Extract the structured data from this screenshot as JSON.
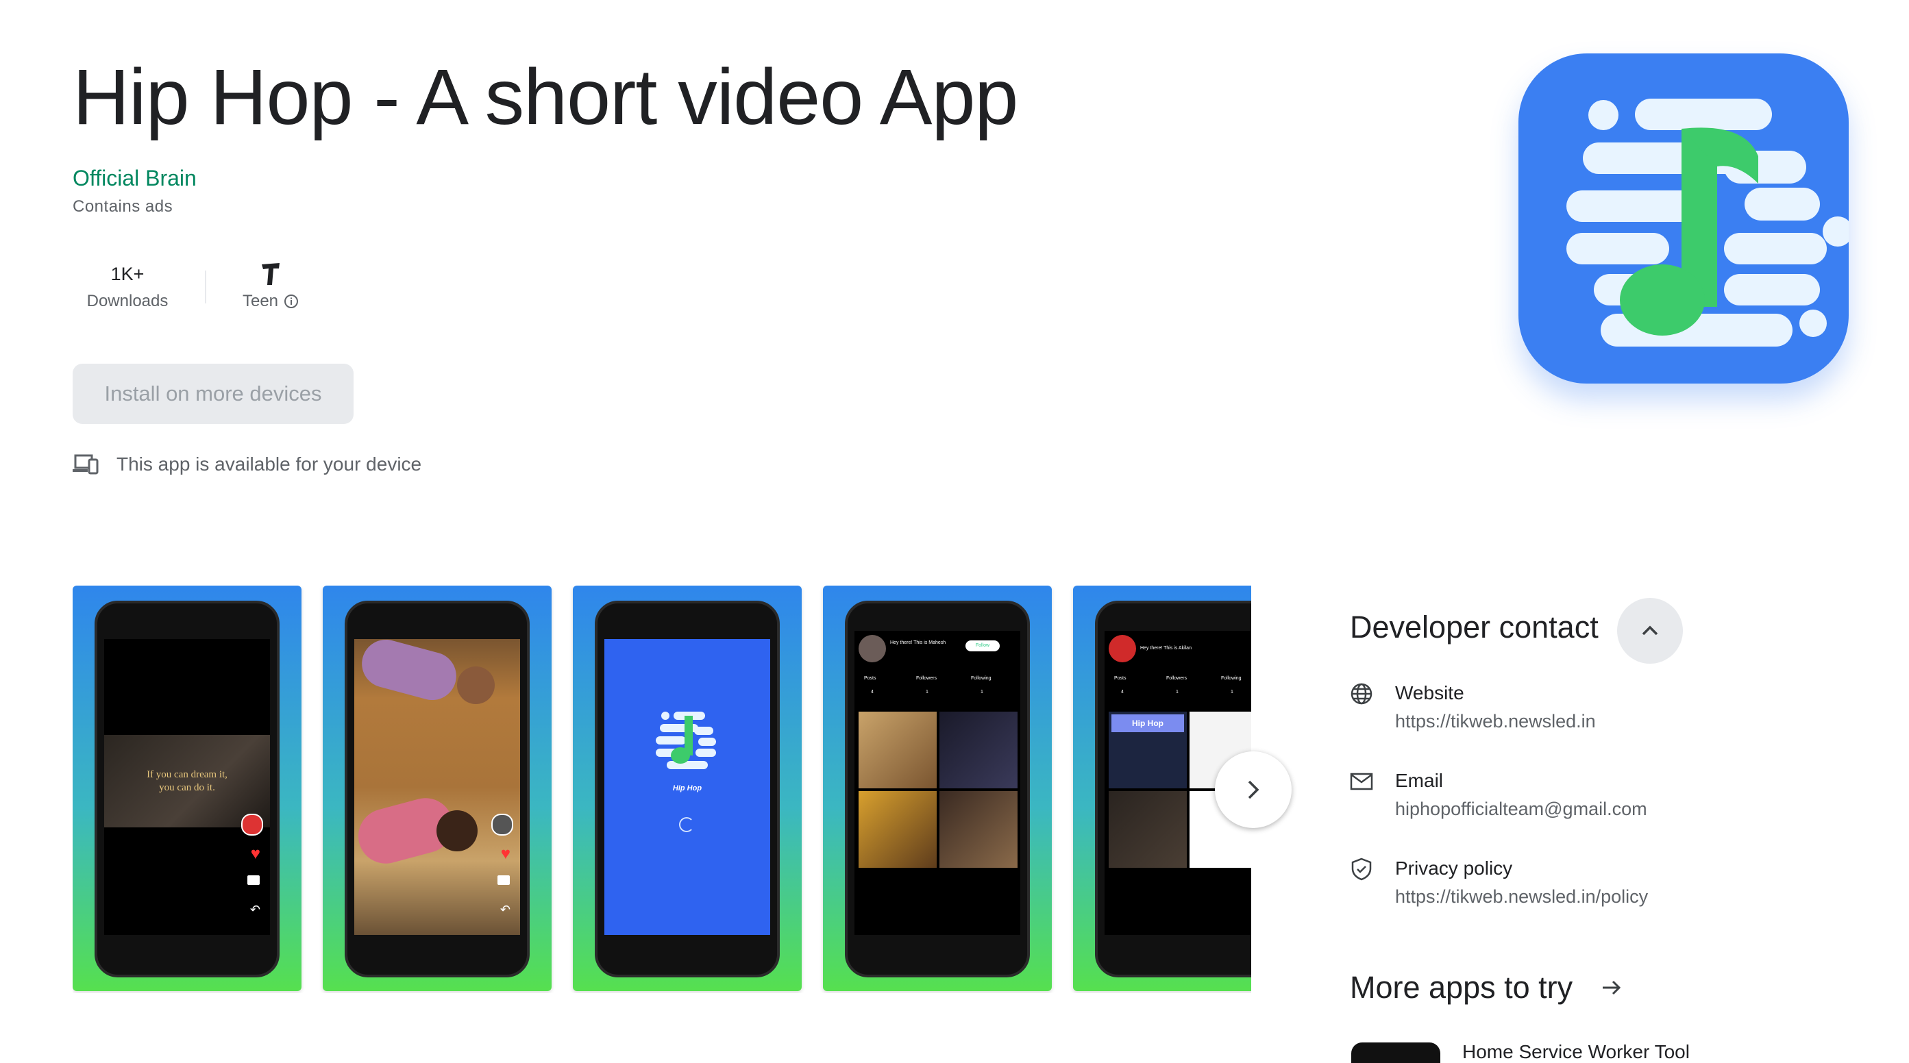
{
  "app": {
    "title": "Hip Hop - A short video App",
    "developer": "Official Brain",
    "ads_note": "Contains ads"
  },
  "stats": {
    "downloads_value": "1K+",
    "downloads_label": "Downloads",
    "rating_label": "Teen",
    "rating_icon": "teen-rating-icon"
  },
  "actions": {
    "install_label": "Install on more devices",
    "availability_text": "This app is available for your device"
  },
  "screenshots": {
    "items": [
      {
        "overlay_text_1": "If you can dream it,",
        "overlay_text_2": "you can do it."
      },
      {
        "overlay_text_1": ""
      },
      {
        "splash_label": "Hip Hop"
      },
      {
        "greeting": "Hey there! This is Mahesh",
        "follow_label": "Follow",
        "posts": "Posts",
        "followers": "Followers",
        "following": "Following",
        "posts_count": "4",
        "followers_count": "1",
        "following_count": "1"
      },
      {
        "greeting": "Hey there! This is Akilan",
        "posts": "Posts",
        "followers": "Followers",
        "following": "Following",
        "posts_count": "4",
        "followers_count": "1",
        "following_count": "1",
        "banner": "Hip Hop"
      }
    ]
  },
  "developer_contact": {
    "title": "Developer contact",
    "website_label": "Website",
    "website_value": "https://tikweb.newsled.in",
    "email_label": "Email",
    "email_value": "hiphopofficialteam@gmail.com",
    "privacy_label": "Privacy policy",
    "privacy_value": "https://tikweb.newsled.in/policy"
  },
  "more_apps": {
    "title": "More apps to try",
    "peek_text": "Home Service Worker Tool"
  },
  "colors": {
    "accent_green": "#01875f",
    "icon_blue": "#3b7ff2",
    "note_green": "#3dcb6b"
  }
}
